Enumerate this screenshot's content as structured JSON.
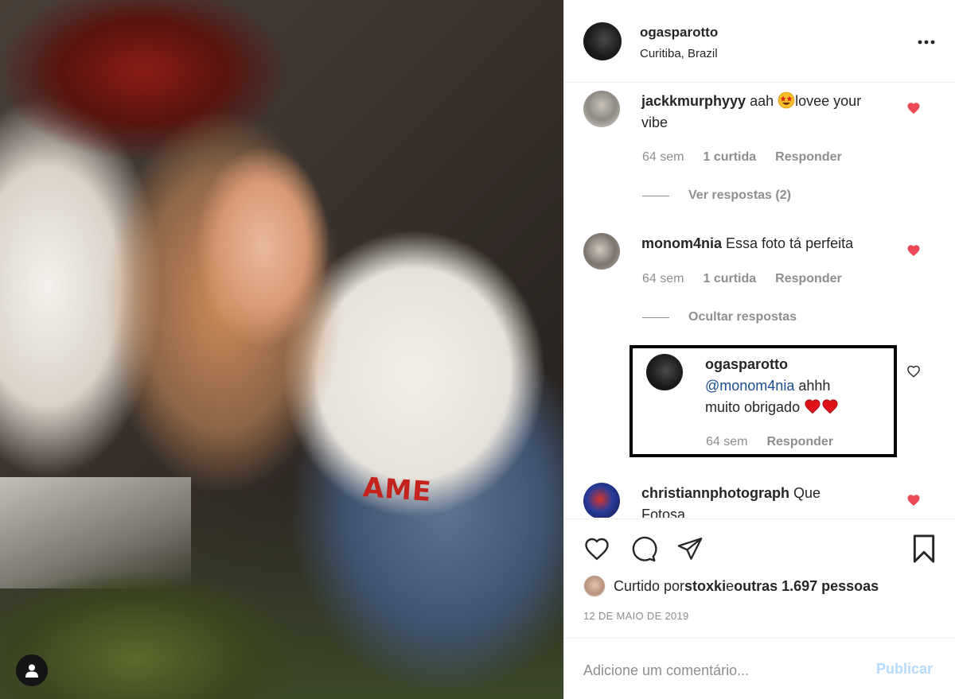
{
  "post": {
    "photo_print_text": "AME",
    "owner": {
      "username": "ogasparotto",
      "location": "Curitiba, Brazil"
    }
  },
  "comments": [
    {
      "username": "jackkmurphyyy",
      "text_before_emoji": " aah",
      "emoji": "star-struck-emoji",
      "text_after_emoji_line1": "lovee your",
      "text_line2": "vibe",
      "time": "64 sem",
      "likes": "1 curtida",
      "reply_label": "Responder",
      "replies_toggle": "Ver respostas (2)",
      "liked": true
    },
    {
      "username": "monom4nia",
      "text": " Essa foto tá perfeita",
      "time": "64 sem",
      "likes": "1 curtida",
      "reply_label": "Responder",
      "replies_toggle": "Ocultar respostas",
      "liked": true
    },
    {
      "username": "ogasparotto",
      "mention": "@monom4nia",
      "text_line1": " ahhh",
      "text_line2": "muito obrigado",
      "emojis": [
        "red-heart-emoji",
        "red-heart-emoji"
      ],
      "time": "64 sem",
      "reply_label": "Responder",
      "liked": false,
      "highlighted": true
    },
    {
      "username": "christiannphotograph",
      "text_line1": " Que",
      "text_line2_partial": "Fotosa",
      "liked": true
    }
  ],
  "actions": {
    "icons": [
      "heart-icon",
      "comment-icon",
      "share-icon",
      "bookmark-icon"
    ]
  },
  "likes_summary": {
    "prefix": "Curtido por ",
    "user": "stoxki",
    "conjunction": " e ",
    "others": "outras 1.697 pessoas"
  },
  "date": "12 DE MAIO DE 2019",
  "add_comment": {
    "placeholder": "Adicione um comentário...",
    "publish_label": "Publicar"
  },
  "colors": {
    "liked_heart": "#ed4956",
    "mention": "#1b4e91",
    "publish_disabled": "#b3dbff"
  }
}
